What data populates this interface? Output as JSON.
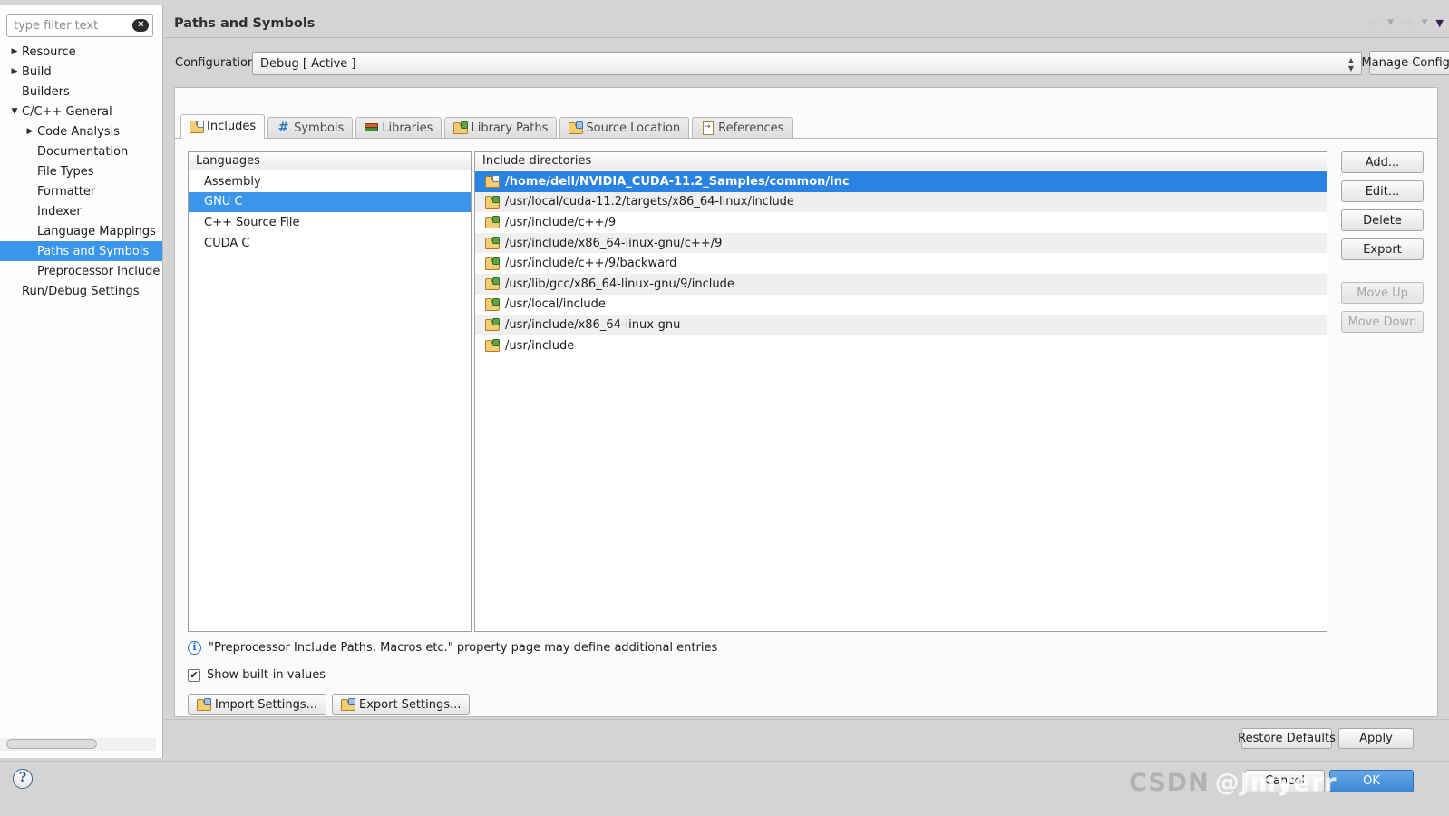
{
  "sidebar": {
    "filter": {
      "placeholder": "type filter text",
      "value": "",
      "clear_icon": "clear-icon"
    },
    "items": [
      {
        "label": "Resource",
        "indent": 0,
        "twisty": "collapsed",
        "selected": false
      },
      {
        "label": "Build",
        "indent": 0,
        "twisty": "collapsed",
        "selected": false
      },
      {
        "label": "Builders",
        "indent": 0,
        "twisty": "none",
        "selected": false
      },
      {
        "label": "C/C++ General",
        "indent": 0,
        "twisty": "expanded",
        "selected": false
      },
      {
        "label": "Code Analysis",
        "indent": 1,
        "twisty": "collapsed",
        "selected": false
      },
      {
        "label": "Documentation",
        "indent": 1,
        "twisty": "none",
        "selected": false
      },
      {
        "label": "File Types",
        "indent": 1,
        "twisty": "none",
        "selected": false
      },
      {
        "label": "Formatter",
        "indent": 1,
        "twisty": "none",
        "selected": false
      },
      {
        "label": "Indexer",
        "indent": 1,
        "twisty": "none",
        "selected": false
      },
      {
        "label": "Language Mappings",
        "indent": 1,
        "twisty": "none",
        "selected": false
      },
      {
        "label": "Paths and Symbols",
        "indent": 1,
        "twisty": "none",
        "selected": true
      },
      {
        "label": "Preprocessor Include Paths, Macros etc.",
        "indent": 1,
        "twisty": "none",
        "selected": false
      },
      {
        "label": "Run/Debug Settings",
        "indent": 0,
        "twisty": "none",
        "selected": false
      }
    ]
  },
  "header": {
    "title": "Paths and Symbols",
    "nav": {
      "back_icon": "arrow-left-icon",
      "back_menu_icon": "chevron-down-icon",
      "forward_icon": "arrow-right-icon",
      "forward_menu_icon": "chevron-down-icon",
      "overflow_icon": "chevron-down-icon"
    }
  },
  "config": {
    "label": "Configuration:",
    "value": "Debug  [ Active ]",
    "spinner_icon": "spinner-updown-icon",
    "manage_label": "Manage Configurations..."
  },
  "tabs": [
    {
      "label": "Includes",
      "icon": "folder-includes-icon",
      "active": true
    },
    {
      "label": "Symbols",
      "icon": "hash-icon",
      "active": false
    },
    {
      "label": "Libraries",
      "icon": "books-icon",
      "active": false
    },
    {
      "label": "Library Paths",
      "icon": "folder-books-icon",
      "active": false
    },
    {
      "label": "Source Location",
      "icon": "folder-source-icon",
      "active": false
    },
    {
      "label": "References",
      "icon": "page-arrow-icon",
      "active": false
    }
  ],
  "languages": {
    "header": "Languages",
    "items": [
      {
        "label": "Assembly",
        "selected": false
      },
      {
        "label": "GNU C",
        "selected": true
      },
      {
        "label": "C++ Source File",
        "selected": false
      },
      {
        "label": "CUDA C",
        "selected": false
      }
    ]
  },
  "includes": {
    "header": "Include directories",
    "items": [
      {
        "path": "/home/dell/NVIDIA_CUDA-11.2_Samples/common/inc",
        "icon": "folder-user-icon",
        "selected": true,
        "builtin": false
      },
      {
        "path": "/usr/local/cuda-11.2/targets/x86_64-linux/include",
        "icon": "folder-builtin-icon",
        "selected": false,
        "builtin": true
      },
      {
        "path": "/usr/include/c++/9",
        "icon": "folder-builtin-icon",
        "selected": false,
        "builtin": true
      },
      {
        "path": "/usr/include/x86_64-linux-gnu/c++/9",
        "icon": "folder-builtin-icon",
        "selected": false,
        "builtin": true
      },
      {
        "path": "/usr/include/c++/9/backward",
        "icon": "folder-builtin-icon",
        "selected": false,
        "builtin": true
      },
      {
        "path": "/usr/lib/gcc/x86_64-linux-gnu/9/include",
        "icon": "folder-builtin-icon",
        "selected": false,
        "builtin": true
      },
      {
        "path": "/usr/local/include",
        "icon": "folder-builtin-icon",
        "selected": false,
        "builtin": true
      },
      {
        "path": "/usr/include/x86_64-linux-gnu",
        "icon": "folder-builtin-icon",
        "selected": false,
        "builtin": true
      },
      {
        "path": "/usr/include",
        "icon": "folder-builtin-icon",
        "selected": false,
        "builtin": true
      }
    ]
  },
  "side_buttons": [
    {
      "label": "Add...",
      "enabled": true
    },
    {
      "label": "Edit...",
      "enabled": true
    },
    {
      "label": "Delete",
      "enabled": true
    },
    {
      "label": "Export",
      "enabled": true
    },
    {
      "label": "Move Up",
      "enabled": false
    },
    {
      "label": "Move Down",
      "enabled": false
    }
  ],
  "hint": {
    "icon": "info-icon",
    "text": "\"Preprocessor Include Paths, Macros etc.\" property page may define additional entries"
  },
  "show_builtin": {
    "label": "Show built-in values",
    "checked": true,
    "check_glyph": "✔"
  },
  "settings_buttons": [
    {
      "label": "Import Settings...",
      "icon": "import-icon"
    },
    {
      "label": "Export Settings...",
      "icon": "export-icon"
    }
  ],
  "footer": {
    "restore_defaults": "Restore Defaults",
    "apply": "Apply",
    "cancel": "Cancel",
    "ok": "OK",
    "help_icon": "help-icon",
    "help_glyph": "?"
  },
  "watermark": {
    "prefix": "CSDN",
    "handle": "@Jmyerr"
  },
  "colors": {
    "selection_blue": "#2a83e2",
    "tree_selection_blue": "#3a95eb",
    "window_bg": "#d4d4d4",
    "list_alt_row": "#efefef",
    "ok_button": "#3d86d4"
  }
}
